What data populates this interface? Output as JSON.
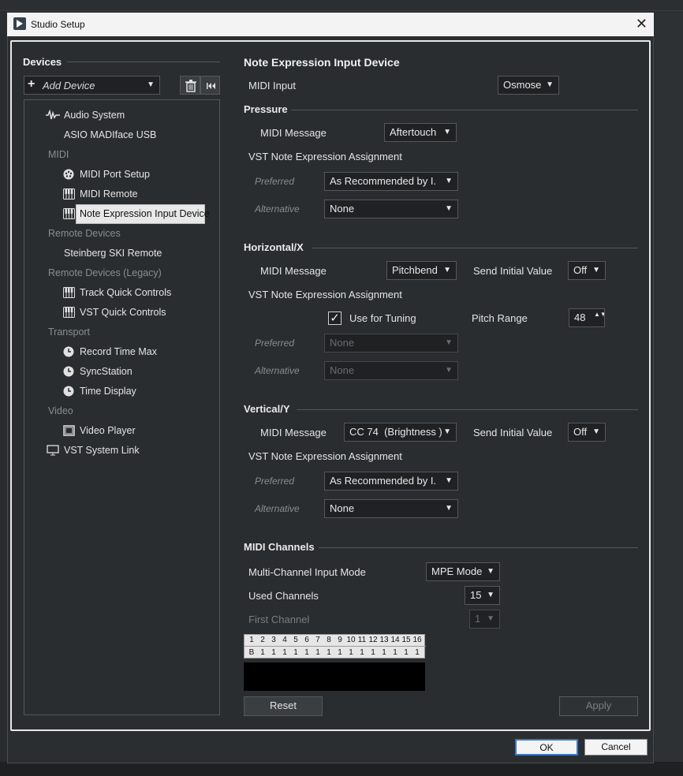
{
  "window": {
    "title": "Studio Setup",
    "close_glyph": "✕"
  },
  "devices": {
    "header": "Devices",
    "add_device": "Add Device",
    "tree": {
      "audio_system": "Audio System",
      "asio": "ASIO MADIface USB",
      "cat_midi": "MIDI",
      "midi_port_setup": "MIDI Port Setup",
      "midi_remote": "MIDI Remote",
      "note_expression": "Note Expression Input Device",
      "cat_remote": "Remote Devices",
      "steinberg_ski": "Steinberg SKI Remote",
      "cat_remote_legacy": "Remote Devices (Legacy)",
      "track_quick": "Track Quick Controls",
      "vst_quick": "VST Quick Controls",
      "cat_transport": "Transport",
      "record_time": "Record Time Max",
      "syncstation": "SyncStation",
      "time_display": "Time Display",
      "cat_video": "Video",
      "video_player": "Video Player",
      "vst_system_link": "VST System Link"
    }
  },
  "panel": {
    "title": "Note Expression Input Device",
    "midi_input_label": "MIDI Input",
    "midi_input_value": "Osmose",
    "pressure": {
      "title": "Pressure",
      "midi_message_label": "MIDI Message",
      "midi_message_value": "Aftertouch",
      "vst_assign": "VST Note Expression Assignment",
      "preferred_label": "Preferred",
      "preferred_value": "As Recommended by I.",
      "alternative_label": "Alternative",
      "alternative_value": "None"
    },
    "horizontal": {
      "title": "Horizontal/X",
      "midi_message_label": "MIDI Message",
      "midi_message_value": "Pitchbend",
      "send_initial_label": "Send Initial Value",
      "send_initial_value": "Off",
      "vst_assign": "VST Note Expression Assignment",
      "use_tuning_label": "Use for Tuning",
      "use_tuning_checked": true,
      "pitch_range_label": "Pitch Range",
      "pitch_range_value": "48",
      "preferred_label": "Preferred",
      "preferred_value": "None",
      "alternative_label": "Alternative",
      "alternative_value": "None"
    },
    "vertical": {
      "title": "Vertical/Y",
      "midi_message_label": "MIDI Message",
      "midi_message_value": "CC 74  (Brightness )",
      "send_initial_label": "Send Initial Value",
      "send_initial_value": "Off",
      "vst_assign": "VST Note Expression Assignment",
      "preferred_label": "Preferred",
      "preferred_value": "As Recommended by I.",
      "alternative_label": "Alternative",
      "alternative_value": "None"
    },
    "midi_channels": {
      "title": "MIDI Channels",
      "multi_channel_label": "Multi-Channel Input Mode",
      "multi_channel_value": "MPE Mode",
      "used_channels_label": "Used Channels",
      "used_channels_value": "15",
      "first_channel_label": "First Channel",
      "first_channel_value": "1",
      "channel_numbers": [
        "1",
        "2",
        "3",
        "4",
        "5",
        "6",
        "7",
        "8",
        "9",
        "10",
        "11",
        "12",
        "13",
        "14",
        "15",
        "16"
      ],
      "channel_row": [
        "B",
        "1",
        "1",
        "1",
        "1",
        "1",
        "1",
        "1",
        "1",
        "1",
        "1",
        "1",
        "1",
        "1",
        "1",
        "1"
      ]
    },
    "reset": "Reset",
    "apply": "Apply"
  },
  "footer": {
    "ok": "OK",
    "cancel": "Cancel"
  },
  "icons": {
    "checkbox_glyph": "✓",
    "arrow": "▼",
    "spin": "▲▼",
    "plus": "+"
  },
  "colors": {
    "panel_bg": "#2a2d30",
    "accent_border": "#e8e8e8",
    "selected_item_bg": "#e8e8e8"
  }
}
